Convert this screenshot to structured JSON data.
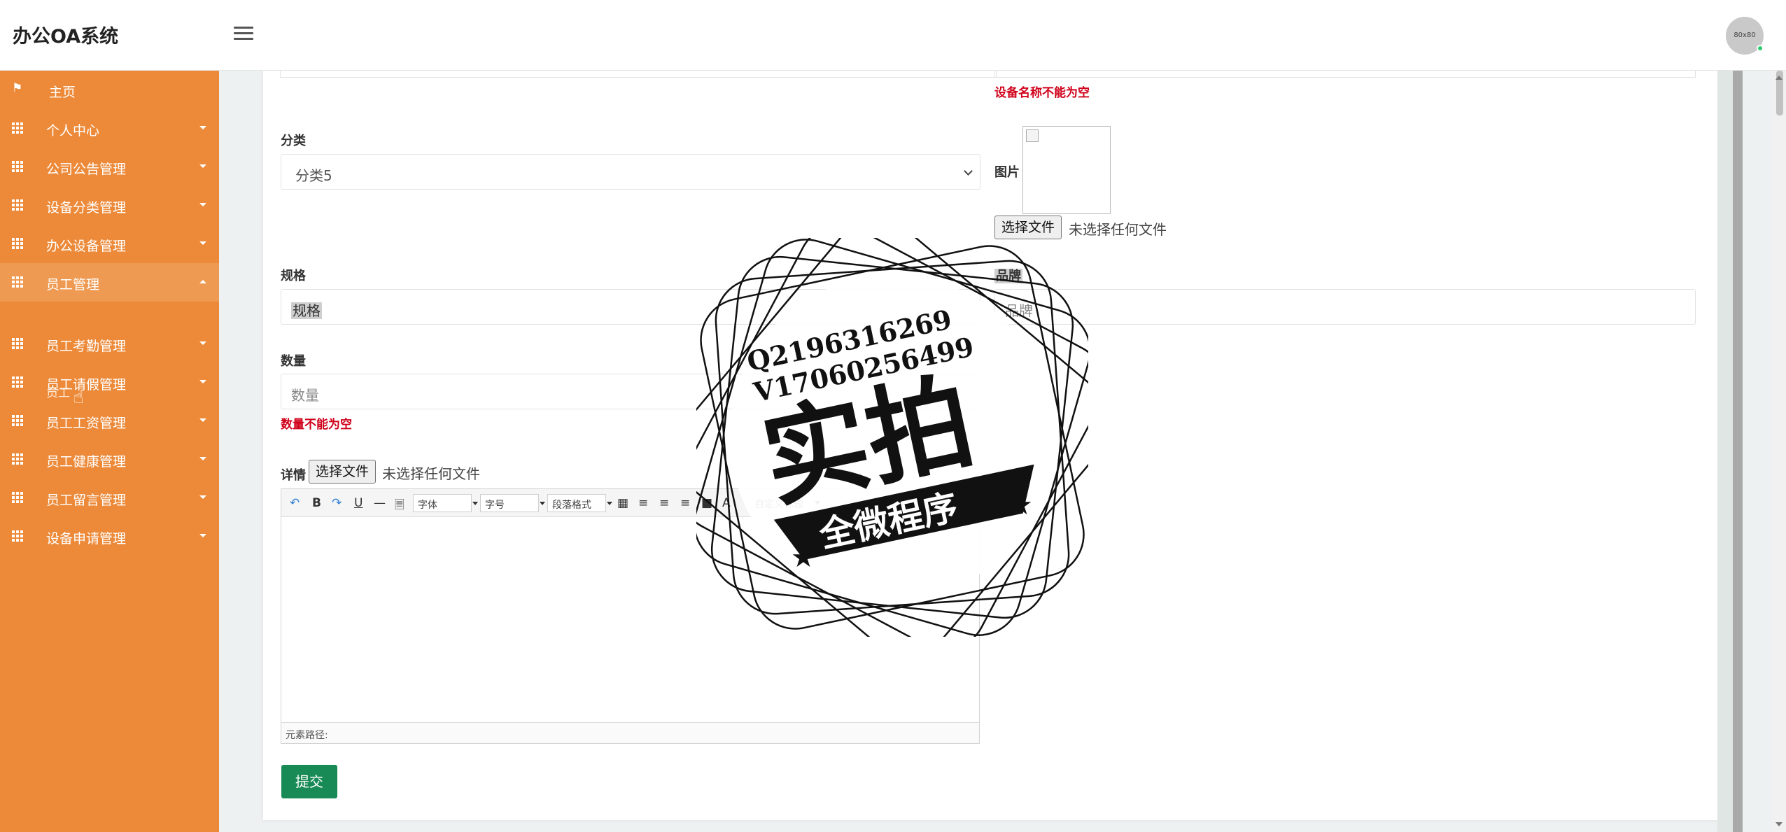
{
  "app": {
    "title": "办公OA系统",
    "avatar_text": "80x80"
  },
  "sidebar": {
    "items": [
      {
        "label": "主页",
        "icon": "flag-icon"
      },
      {
        "label": "个人中心",
        "icon": "grid-icon"
      },
      {
        "label": "公司公告管理",
        "icon": "grid-icon"
      },
      {
        "label": "设备分类管理",
        "icon": "grid-icon"
      },
      {
        "label": "办公设备管理",
        "icon": "grid-icon"
      },
      {
        "label": "员工管理",
        "icon": "grid-icon",
        "expanded": true
      },
      {
        "label": "员工考勤管理",
        "icon": "grid-icon"
      },
      {
        "label": "员工请假管理",
        "icon": "grid-icon"
      },
      {
        "label": "员工工资管理",
        "icon": "grid-icon"
      },
      {
        "label": "员工健康管理",
        "icon": "grid-icon"
      },
      {
        "label": "员工留言管理",
        "icon": "grid-icon"
      },
      {
        "label": "设备申请管理",
        "icon": "grid-icon"
      }
    ],
    "sub_item": "员工"
  },
  "form": {
    "name_error": "设备名称不能为空",
    "category": {
      "label": "分类",
      "value": "分类5"
    },
    "image": {
      "label": "图片",
      "file_button": "选择文件",
      "file_status": "未选择任何文件"
    },
    "spec": {
      "label": "规格",
      "placeholder": "规格"
    },
    "brand": {
      "label": "品牌",
      "placeholder": "品牌"
    },
    "quantity": {
      "label": "数量",
      "placeholder": "数量",
      "error": "数量不能为空"
    },
    "details": {
      "label": "详情",
      "file_button": "选择文件",
      "file_status": "未选择任何文件"
    },
    "editor": {
      "font_family": "字体",
      "font_size": "字号",
      "paragraph": "段落格式",
      "custom_title": "自定义标题",
      "footer": "元素路径:"
    },
    "submit": "提交"
  },
  "watermark": {
    "line1": "Q2196316269",
    "line2": "V17060256499",
    "big": "实拍",
    "ribbon": "全微程序"
  }
}
